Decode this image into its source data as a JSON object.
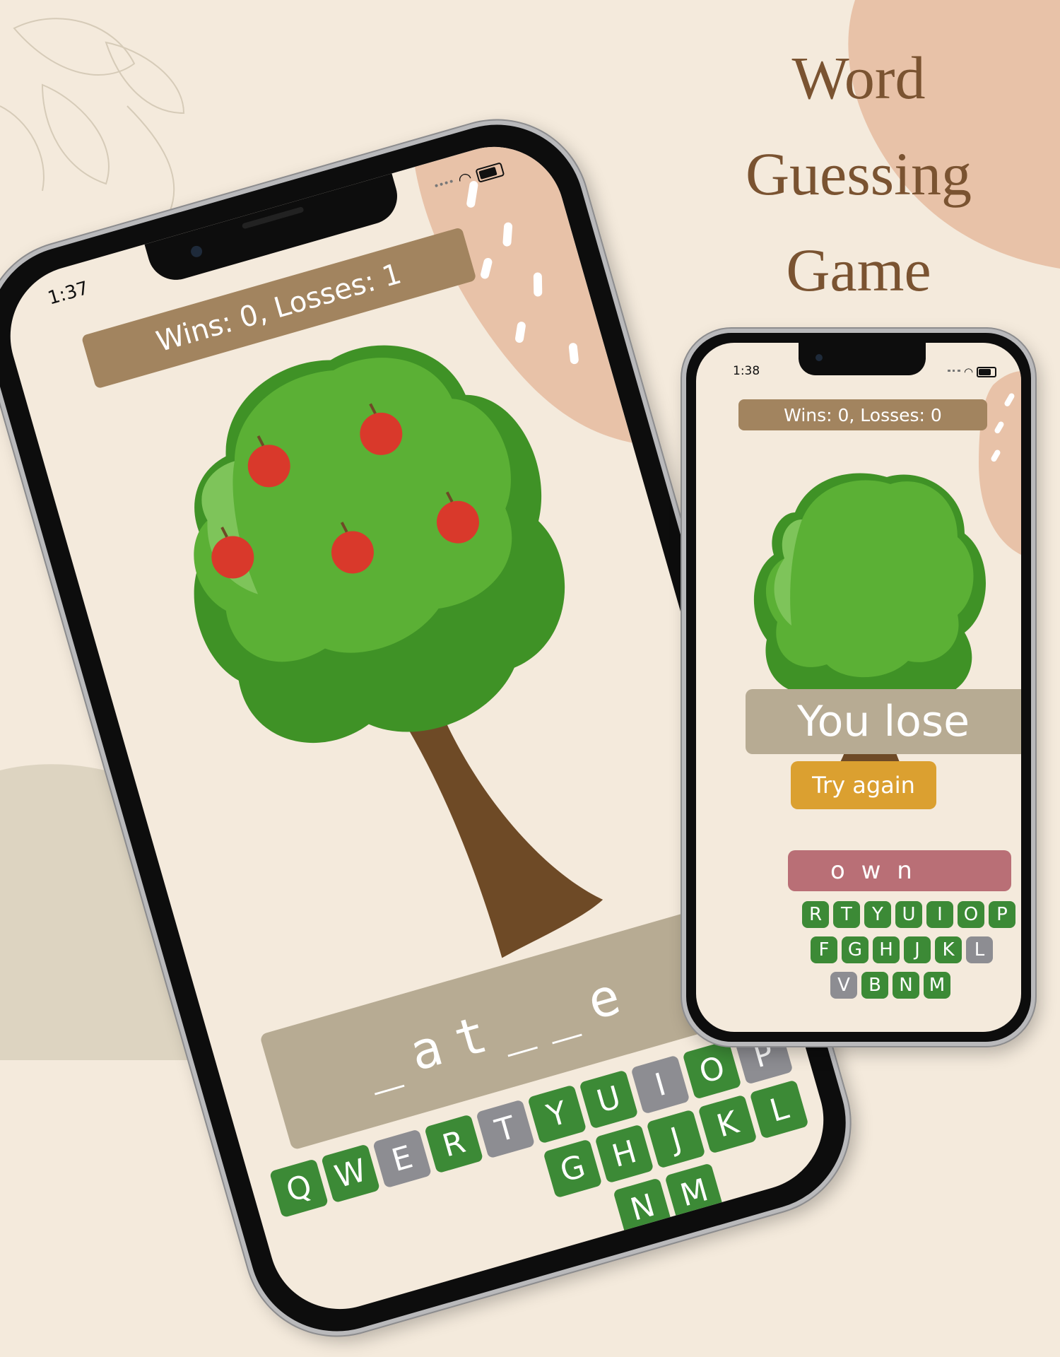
{
  "colors": {
    "background": "#f4eadc",
    "title": "#7a5331",
    "score_bar": "#a2845f",
    "word_bar": "#b7ab93",
    "key_correct": "#3c8a36",
    "key_used": "#8d8d92",
    "lose_word_bar": "#b96f76",
    "try_again": "#dba030",
    "tree_green": "#5bb035",
    "trunk": "#6e4a26",
    "apple": "#d9392b",
    "peach_blob": "#e8c2a8"
  },
  "title": {
    "line1": "Word",
    "line2": "Guessing",
    "line3": "Game"
  },
  "phone_left": {
    "time": "1:37",
    "score": "Wins: 0, Losses: 1",
    "masked_word": "_at__e",
    "keyboard_row1": [
      {
        "k": "Q",
        "s": "g"
      },
      {
        "k": "W",
        "s": "g"
      },
      {
        "k": "E",
        "s": "x"
      },
      {
        "k": "R",
        "s": "g"
      },
      {
        "k": "T",
        "s": "x"
      },
      {
        "k": "Y",
        "s": "g"
      },
      {
        "k": "U",
        "s": "g"
      },
      {
        "k": "I",
        "s": "x"
      },
      {
        "k": "O",
        "s": "g"
      },
      {
        "k": "P",
        "s": "x"
      }
    ],
    "keyboard_row2": [
      {
        "k": "G",
        "s": "g"
      },
      {
        "k": "H",
        "s": "g"
      },
      {
        "k": "J",
        "s": "g"
      },
      {
        "k": "K",
        "s": "g"
      },
      {
        "k": "L",
        "s": "g"
      }
    ],
    "keyboard_row3": [
      {
        "k": "N",
        "s": "g"
      },
      {
        "k": "M",
        "s": "g"
      }
    ]
  },
  "phone_right": {
    "time": "1:38",
    "score": "Wins: 0, Losses: 0",
    "result": "You lose",
    "try_again": "Try again",
    "word_partial": "o w n",
    "keyboard_row1": [
      {
        "k": "R",
        "s": "g"
      },
      {
        "k": "T",
        "s": "g"
      },
      {
        "k": "Y",
        "s": "g"
      },
      {
        "k": "U",
        "s": "g"
      },
      {
        "k": "I",
        "s": "g"
      },
      {
        "k": "O",
        "s": "g"
      },
      {
        "k": "P",
        "s": "g"
      }
    ],
    "keyboard_row2": [
      {
        "k": "F",
        "s": "g"
      },
      {
        "k": "G",
        "s": "g"
      },
      {
        "k": "H",
        "s": "g"
      },
      {
        "k": "J",
        "s": "g"
      },
      {
        "k": "K",
        "s": "g"
      },
      {
        "k": "L",
        "s": "x"
      }
    ],
    "keyboard_row3": [
      {
        "k": "V",
        "s": "x"
      },
      {
        "k": "B",
        "s": "g"
      },
      {
        "k": "N",
        "s": "g"
      },
      {
        "k": "M",
        "s": "g"
      }
    ]
  }
}
